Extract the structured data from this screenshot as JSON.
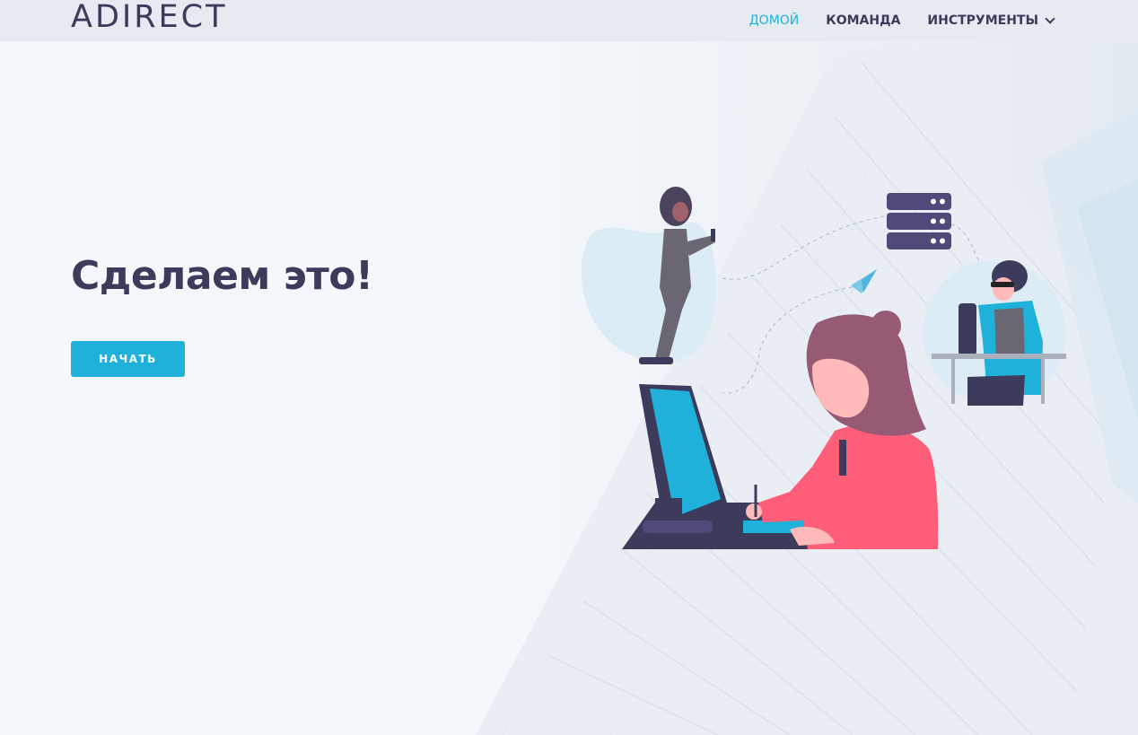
{
  "brand": {
    "logo_text": "ADIRECT"
  },
  "nav": {
    "items": [
      {
        "label": "ДОМОЙ",
        "active": true
      },
      {
        "label": "КОМАНДА",
        "active": false
      },
      {
        "label": "ИНСТРУМЕНТЫ",
        "active": false,
        "has_dropdown": true
      }
    ]
  },
  "hero": {
    "title": "Сделаем это!",
    "cta_label": "НАЧАТЬ"
  },
  "colors": {
    "accent": "#1fb1d9",
    "text_dark": "#3d3b5c",
    "nav_bg": "#e6ebf2",
    "page_bg": "#f4f7fb",
    "shirt_pink": "#ff5e78",
    "hair_mauve": "#975a75"
  },
  "icons": {
    "nav_dropdown": "chevron-down-icon",
    "illustration": "team-at-work-illustration"
  }
}
